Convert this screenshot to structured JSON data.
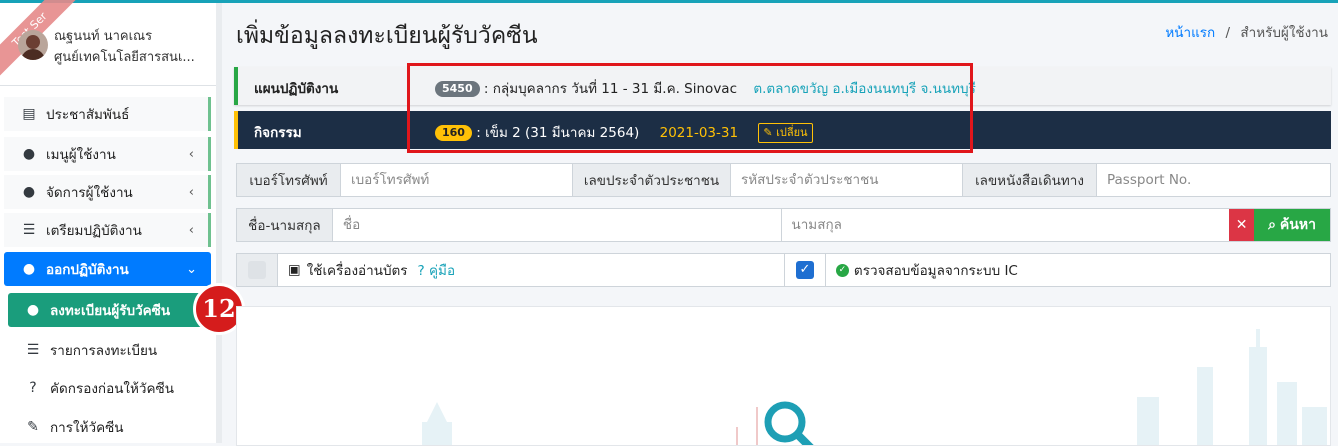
{
  "user": {
    "name": "ณฐนนท์ นาคเณร",
    "org": "ศูนย์เทคโนโลยีสารสนเ...",
    "ribbon": "Test Ser"
  },
  "sidebar": {
    "items": [
      {
        "label": "ประชาสัมพันธ์",
        "icon": "newspaper-icon"
      },
      {
        "label": "เมนูผู้ใช้งาน",
        "icon": "user-icon"
      },
      {
        "label": "จัดการผู้ใช้งาน",
        "icon": "user-edit-icon"
      },
      {
        "label": "เตรียมปฏิบัติงาน",
        "icon": "list-icon"
      },
      {
        "label": "ออกปฏิบัติงาน",
        "icon": "user-nurse-icon"
      }
    ],
    "subitems": [
      {
        "label": "ลงทะเบียนผู้รับวัคซีน",
        "icon": "user-edit-icon"
      },
      {
        "label": "รายการลงทะเบียน",
        "icon": "list-icon"
      },
      {
        "label": "คัดกรองก่อนให้วัคซีน",
        "icon": "question-circle-icon"
      },
      {
        "label": "การให้วัคซีน",
        "icon": "syringe-icon"
      }
    ],
    "step_badge": "12"
  },
  "page": {
    "title": "เพิ่มข้อมูลลงทะเบียนผู้รับวัคซีน"
  },
  "breadcrumb": {
    "home": "หน้าแรก",
    "separator": "/",
    "current": "สำหรับผู้ใช้งาน"
  },
  "plan": {
    "label": "แผนปฏิบัติงาน",
    "code": "5450",
    "text": ": กลุ่มบุคลากร วันที่ 11 - 31 มี.ค. Sinovac",
    "location": "ต.ตลาดขวัญ อ.เมืองนนทบุรี จ.นนทบุรี"
  },
  "activity": {
    "label": "กิจกรรม",
    "code": "160",
    "text": ": เข็ม 2 (31 มีนาคม 2564)",
    "date": "2021-03-31",
    "change_label": "เปลี่ยน"
  },
  "search": {
    "phone_label": "เบอร์โทรศัพท์",
    "phone_placeholder": "เบอร์โทรศัพท์",
    "cid_label": "เลขประจำตัวประชาชน",
    "cid_placeholder": "รหัสประจำตัวประชาชน",
    "passport_label": "เลขหนังสือเดินทาง",
    "passport_placeholder": "Passport No.",
    "name_label": "ชื่อ-นามสกุล",
    "first_placeholder": "ชื่อ",
    "last_placeholder": "นามสกุล",
    "clear_label": "✕",
    "search_label": "ค้นหา"
  },
  "options": {
    "card_reader_label": "ใช้เครื่องอ่านบัตร",
    "help_label": "คู่มือ",
    "card_reader_checked": false,
    "ic_label": "ตรวจสอบข้อมูลจากระบบ IC",
    "ic_checked": true
  },
  "colors": {
    "primary": "#007bff",
    "current_sub": "#1a9d7c",
    "activity_bg": "#1c2e45",
    "highlight": "#e0161b",
    "accent_yellow": "#ffc107"
  }
}
